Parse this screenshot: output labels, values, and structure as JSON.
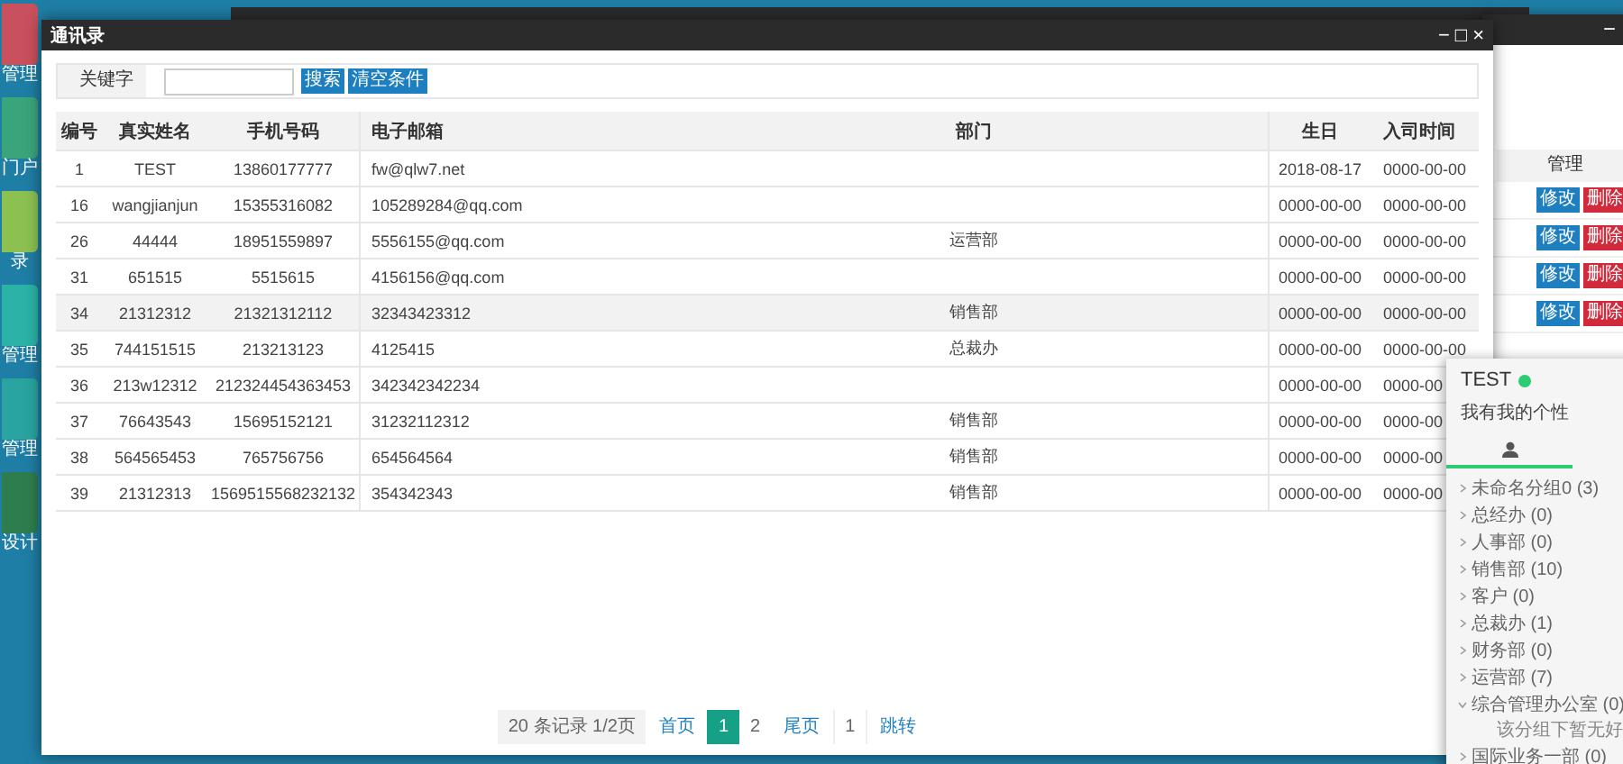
{
  "desktop_icons": [
    {
      "label": "管理",
      "color": "#c9505d"
    },
    {
      "label": "门户",
      "color": "#3aa57a"
    },
    {
      "label": "录",
      "color": "#8cc152"
    },
    {
      "label": "管理",
      "color": "#2ab3a6"
    },
    {
      "label": "管理",
      "color": "#2aa4a0"
    },
    {
      "label": "设计",
      "color": "#2e7d4f"
    }
  ],
  "window": {
    "title": "通讯录",
    "controls": [
      "−",
      "□",
      "×"
    ],
    "search": {
      "label": "关键字",
      "buttons": [
        "搜索",
        "清空条件"
      ]
    },
    "table": {
      "columns": [
        "编号",
        "真实姓名",
        "手机号码",
        "电子邮箱",
        "部门",
        "生日",
        "入司时间"
      ],
      "rows": [
        {
          "cells": [
            "1",
            "TEST",
            "13860177777",
            "fw@qlw7.net",
            "",
            "2018-08-17",
            "0000-00-00"
          ],
          "selected": false
        },
        {
          "cells": [
            "16",
            "wangjianjun",
            "15355316082",
            "105289284@qq.com",
            "",
            "0000-00-00",
            "0000-00-00"
          ],
          "selected": false
        },
        {
          "cells": [
            "26",
            "44444",
            "18951559897",
            "5556155@qq.com",
            "运营部",
            "0000-00-00",
            "0000-00-00"
          ],
          "selected": false
        },
        {
          "cells": [
            "31",
            "651515",
            "5515615",
            "4156156@qq.com",
            "",
            "0000-00-00",
            "0000-00-00"
          ],
          "selected": false
        },
        {
          "cells": [
            "34",
            "21312312",
            "21321312112",
            "32343423312",
            "销售部",
            "0000-00-00",
            "0000-00-00"
          ],
          "selected": true
        },
        {
          "cells": [
            "35",
            "744151515",
            "213213123",
            "4125415",
            "总裁办",
            "0000-00-00",
            "0000-00-00"
          ],
          "selected": false
        },
        {
          "cells": [
            "36",
            "213w12312",
            "212324454363453",
            "342342342234",
            "",
            "0000-00-00",
            "0000-00"
          ],
          "selected": false
        },
        {
          "cells": [
            "37",
            "76643543",
            "15695152121",
            "31232112312",
            "销售部",
            "0000-00-00",
            "0000-00"
          ],
          "selected": false
        },
        {
          "cells": [
            "38",
            "564565453",
            "765756756",
            "654564564",
            "销售部",
            "0000-00-00",
            "0000-00"
          ],
          "selected": false
        },
        {
          "cells": [
            "39",
            "21312313",
            "1569515568232132",
            "354342343",
            "销售部",
            "0000-00-00",
            "0000-00"
          ],
          "selected": false
        }
      ]
    },
    "pagination": {
      "summary": "20 条记录 1/2页",
      "first": "首页",
      "pages": [
        {
          "label": "1",
          "selected": true
        },
        {
          "label": "2",
          "selected": false
        }
      ],
      "last": "尾页",
      "jump_value": "1",
      "jump": "跳转"
    }
  },
  "back_window": {
    "controls": [
      "−"
    ],
    "column": "管理",
    "rows": [
      {
        "edit": "修改",
        "delete": "删除"
      },
      {
        "edit": "修改",
        "delete": "删除"
      },
      {
        "edit": "修改",
        "delete": "删除"
      },
      {
        "edit": "修改",
        "delete": "删除"
      }
    ]
  },
  "chat": {
    "name": "TEST",
    "online": true,
    "signature": "我有我的个性",
    "groups": [
      {
        "label": "未命名分组0 (3)",
        "expanded": false
      },
      {
        "label": "总经办 (0)",
        "expanded": false
      },
      {
        "label": "人事部 (0)",
        "expanded": false
      },
      {
        "label": "销售部 (10)",
        "expanded": false
      },
      {
        "label": "客户 (0)",
        "expanded": false
      },
      {
        "label": "总裁办 (1)",
        "expanded": false
      },
      {
        "label": "财务部 (0)",
        "expanded": false
      },
      {
        "label": "运营部 (7)",
        "expanded": false
      },
      {
        "label": "综合管理办公室 (0)",
        "expanded": true,
        "empty_note": "该分组下暂无好"
      },
      {
        "label": "国际业务一部 (0)",
        "expanded": false
      }
    ]
  }
}
